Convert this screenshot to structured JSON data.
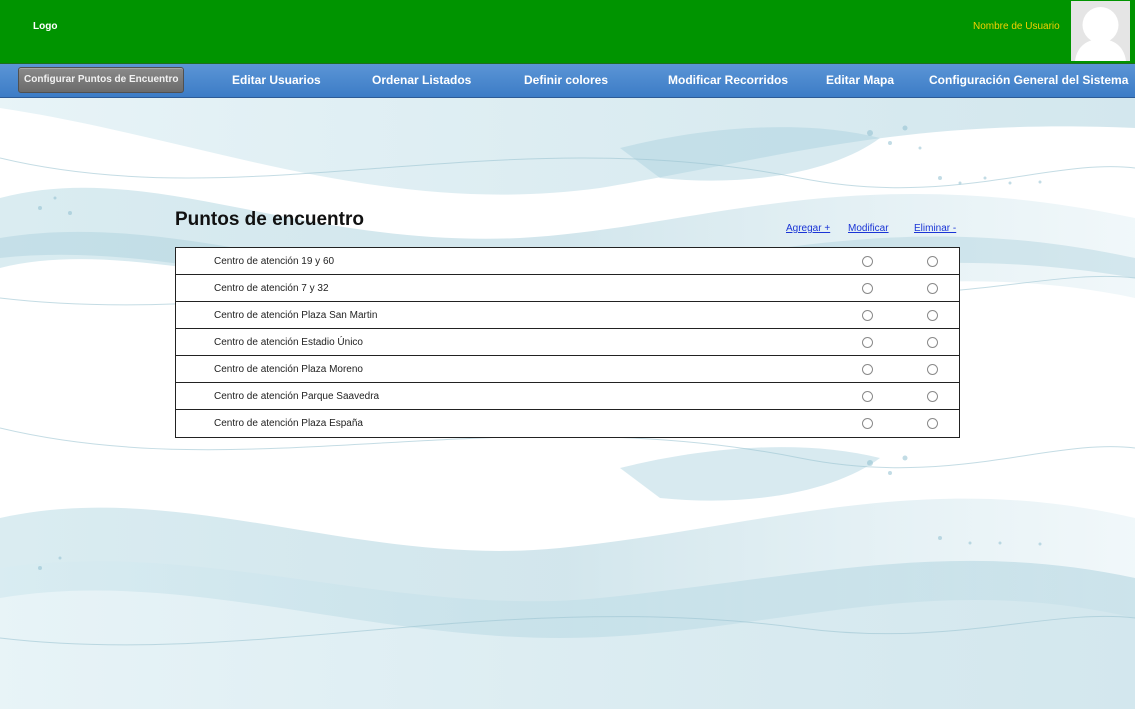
{
  "header": {
    "logo": "Logo",
    "username": "Nombre de Usuario",
    "avatar_icon": "user-avatar-icon",
    "background_color": "#009400",
    "username_color": "#f3d000"
  },
  "nav": {
    "background_color": "#3c7cc6",
    "items": [
      {
        "label": "Configurar Puntos de Encuentro",
        "active": true
      },
      {
        "label": "Editar Usuarios",
        "active": false
      },
      {
        "label": "Ordenar Listados",
        "active": false
      },
      {
        "label": "Definir colores",
        "active": false
      },
      {
        "label": "Modificar Recorridos",
        "active": false
      },
      {
        "label": "Editar Mapa",
        "active": false
      },
      {
        "label": "Configuración General del Sistema",
        "active": false
      }
    ]
  },
  "main": {
    "title": "Puntos de encuentro",
    "actions": {
      "add": "Agregar +",
      "modify": "Modificar",
      "delete": "Eliminar -"
    },
    "link_color": "#1a34d6",
    "rows": [
      {
        "label": "Centro de atención 19 y 60"
      },
      {
        "label": "Centro de atención 7 y 32"
      },
      {
        "label": "Centro de atención Plaza San Martin"
      },
      {
        "label": "Centro de atención Estadio Único"
      },
      {
        "label": "Centro de atención Plaza Moreno"
      },
      {
        "label": "Centro de atención Parque Saavedra"
      },
      {
        "label": "Centro de atención Plaza España"
      }
    ]
  }
}
